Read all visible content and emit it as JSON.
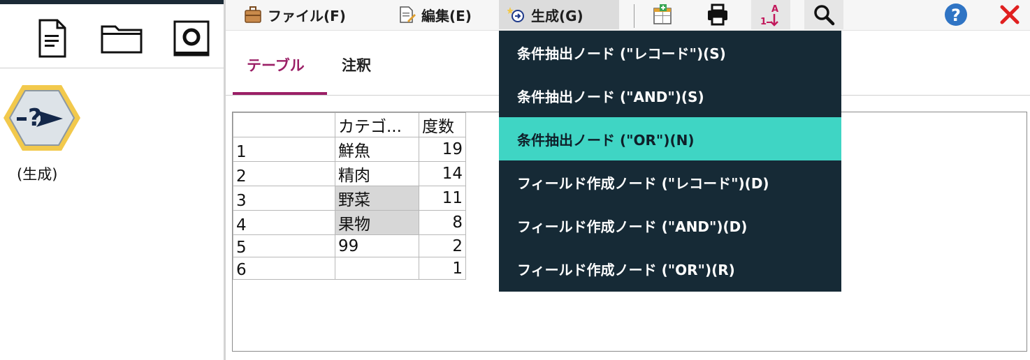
{
  "left_pane": {
    "toolbar_icons": [
      "new-document-icon",
      "open-folder-icon",
      "save-disk-icon"
    ],
    "node": {
      "icon": "select-node-icon",
      "label": "(生成)"
    }
  },
  "menubar": {
    "file": "ファイル(F)",
    "edit": "編集(E)",
    "generate": "生成(G)",
    "tools": [
      "export-table-icon",
      "print-icon",
      "sort-icon",
      "search-icon"
    ],
    "help_icon": "help-icon",
    "close_icon": "close-icon"
  },
  "tabs": [
    {
      "label": "テーブル",
      "active": true
    },
    {
      "label": "注釈",
      "active": false
    }
  ],
  "table": {
    "columns": [
      "",
      "カテゴ...",
      "度数"
    ],
    "rows": [
      {
        "index": "1",
        "category": "鮮魚",
        "count": "19",
        "highlight": false
      },
      {
        "index": "2",
        "category": "精肉",
        "count": "14",
        "highlight": false
      },
      {
        "index": "3",
        "category": "野菜",
        "count": "11",
        "highlight": true
      },
      {
        "index": "4",
        "category": "果物",
        "count": "8",
        "highlight": true
      },
      {
        "index": "5",
        "category": "99",
        "count": "2",
        "highlight": false
      },
      {
        "index": "6",
        "category": "",
        "count": "1",
        "highlight": false
      }
    ]
  },
  "dropdown": {
    "items": [
      {
        "label": "条件抽出ノード (\"レコード\")(S)",
        "selected": false
      },
      {
        "label": "条件抽出ノード (\"AND\")(S)",
        "selected": false
      },
      {
        "label": "条件抽出ノード (\"OR\")(N)",
        "selected": true
      },
      {
        "label": "フィールド作成ノード (\"レコード\")(D)",
        "selected": false
      },
      {
        "label": "フィールド作成ノード (\"AND\")(D)",
        "selected": false
      },
      {
        "label": "フィールド作成ノード (\"OR\")(R)",
        "selected": false
      }
    ]
  },
  "colors": {
    "accent": "#9b1f66",
    "menu_bg": "#162a36",
    "menu_selected": "#3fd5c4",
    "cell_highlight": "#d7d7d7",
    "node_ring": "#f2c94c"
  }
}
